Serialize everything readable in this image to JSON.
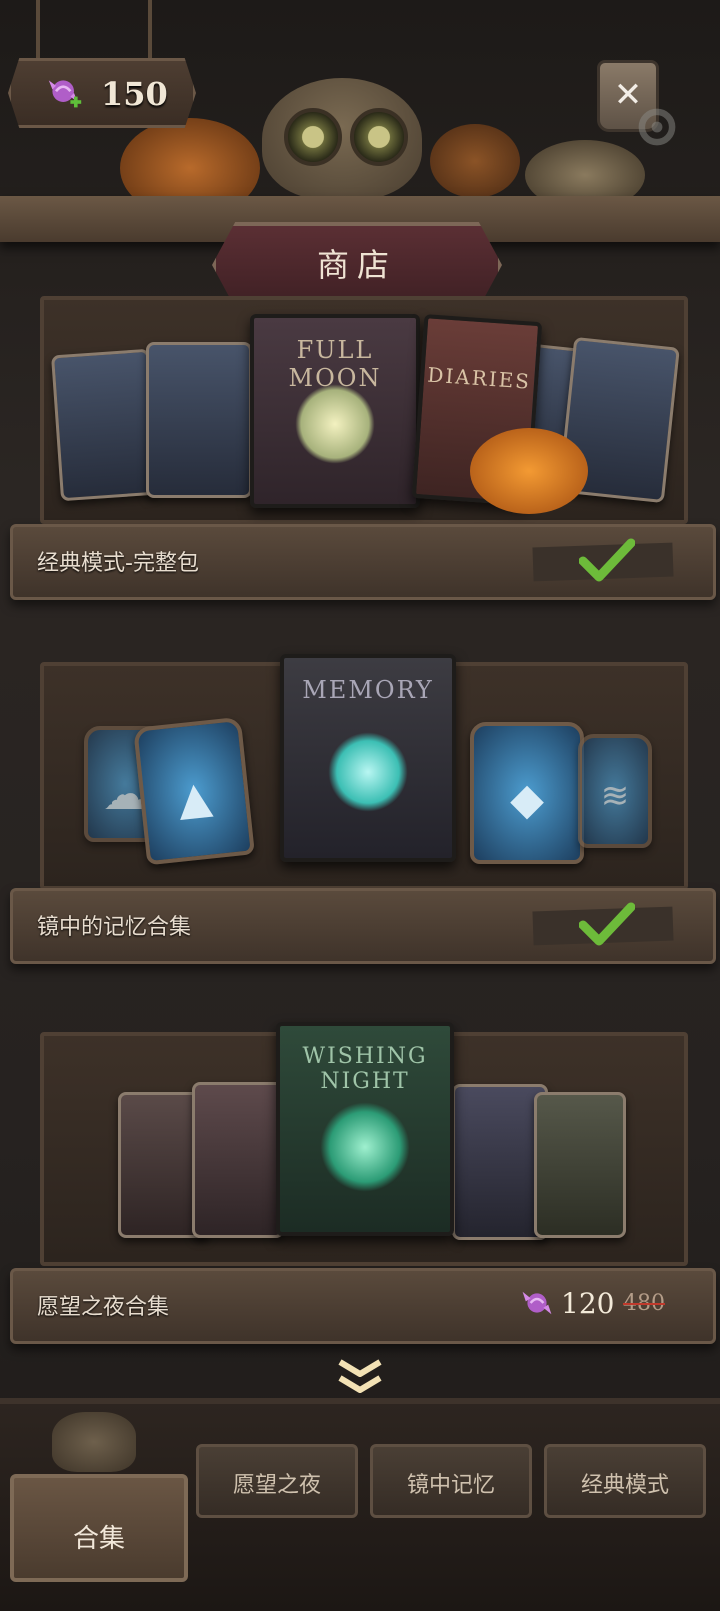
{
  "header": {
    "currency_amount": "150",
    "title": "商店"
  },
  "packs": [
    {
      "label": "经典模式-完整包",
      "owned": true,
      "book_titles": [
        "FULL MOON",
        "DIARIES"
      ]
    },
    {
      "label": "镜中的记忆合集",
      "owned": true,
      "book_titles": [
        "MEMORY"
      ]
    },
    {
      "label": "愿望之夜合集",
      "owned": false,
      "book_titles": [
        "WISHING NIGHT"
      ],
      "price": "120",
      "original_price": "480"
    }
  ],
  "tabs": [
    {
      "label": "合集",
      "active": true
    },
    {
      "label": "愿望之夜",
      "active": false
    },
    {
      "label": "镜中记忆",
      "active": false
    },
    {
      "label": "经典模式",
      "active": false
    }
  ],
  "colors": {
    "candy": "#b05ec8",
    "check": "#6dbb3a",
    "title_plaque": "#5b2f34",
    "price_strike": "#c0392b"
  }
}
